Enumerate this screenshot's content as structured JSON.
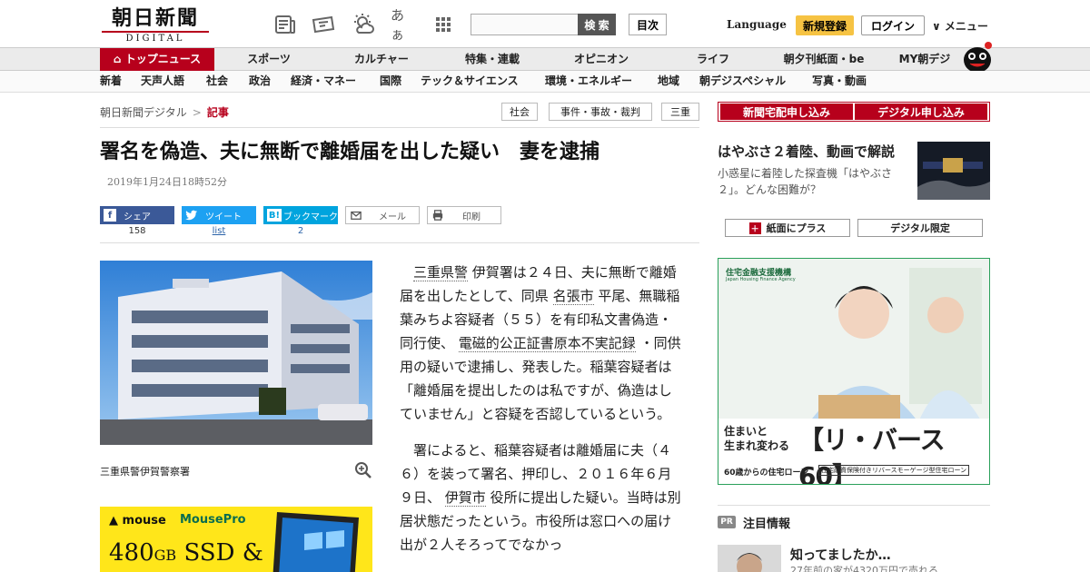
{
  "header": {
    "logo_jp": "朝日新聞",
    "logo_en": "DIGITAL",
    "icon_text_size": "あぁ",
    "search_placeholder": "",
    "search_label": "検 索",
    "toc_label": "目次",
    "language_label": "Language",
    "register_label": "新規登録",
    "login_label": "ログイン",
    "menu_label": "∨ メニュー"
  },
  "nav_main": [
    {
      "label": "トップニュース",
      "active": true
    },
    {
      "label": "スポーツ"
    },
    {
      "label": "カルチャー"
    },
    {
      "label": "特集・連載"
    },
    {
      "label": "オピニオン"
    },
    {
      "label": "ライフ"
    },
    {
      "label": "朝夕刊紙面・be"
    },
    {
      "label": "MY朝デジ"
    }
  ],
  "nav_sub": [
    "新着",
    "天声人語",
    "社会",
    "政治",
    "経済・マネー",
    "国際",
    "テック＆サイエンス",
    "環境・エネルギー",
    "地域",
    "朝デジスペシャル",
    "写真・動画"
  ],
  "breadcrumb": {
    "home": "朝日新聞デジタル",
    "sep": ">",
    "current": "記事"
  },
  "tags": [
    "社会",
    "事件・事故・裁判",
    "三重"
  ],
  "article": {
    "title": "署名を偽造、夫に無断で離婚届を出した疑い　妻を逮捕",
    "date": "2019年1月24日18時52分",
    "photo_caption": "三重県警伊賀警察署",
    "p1_a": "三重県警",
    "p1_b": " 伊賀署は２４日、夫に無断で離婚届を出したとして、同県 ",
    "p1_c": "名張市",
    "p1_d": " 平尾、無職稲葉みちよ容疑者（５５）を有印私文書偽造・同行使、 ",
    "p1_e": "電磁的公正証書原本不実記録",
    "p1_f": " ・同供用の疑いで逮捕し、発表した。稲葉容疑者は「離婚届を提出したのは私ですが、偽造はしていません」と容疑を否認しているという。",
    "p2_a": "署によると、稲葉容疑者は離婚届に夫（４６）を装って署名、押印し、２０１６年６月９日、 ",
    "p2_b": "伊賀市",
    "p2_c": " 役所に提出した疑い。当時は別居状態だったという。市役所は窓口への届け出が２人そろってでなかっ"
  },
  "share": {
    "facebook_label": "シェア",
    "facebook_count": "158",
    "twitter_label": "ツイート",
    "twitter_count": "list",
    "hatena_label": "ブックマーク",
    "hatena_count": "2",
    "mail_label": "メール",
    "print_label": "印刷"
  },
  "sidebar": {
    "subscribe_paper": "新聞宅配申し込み",
    "subscribe_digital": "デジタル申し込み",
    "feature_title": "はやぶさ２着陸、動画で解説",
    "feature_desc": "小惑星に着陸した探査機「はやぶさ２」。どんな困難が？",
    "tab_plus": "紙面にプラス",
    "tab_digital": "デジタル限定",
    "pr_badge": "PR",
    "pr_title": "注目情報",
    "pr_item_title": "知ってましたか…",
    "pr_item_desc": "27年前の家が4320万円で売れる"
  },
  "ads": {
    "pc_brand": "mouse",
    "pc_line": "MousePro",
    "pc_spec_num": "480",
    "pc_spec_unit": "GB",
    "pc_spec_rest": " SSD &",
    "jhf_org": "住宅金融支援機構",
    "jhf_org_en": "Japan Housing Finance Agency",
    "jhf_line1": "住まいと",
    "jhf_line2": "生まれ変わる",
    "jhf_product": "【リ・バース60】",
    "jhf_sub1": "60歳からの住宅ローン",
    "jhf_sub2": "住宅融資保険付きリバースモーゲージ型住宅ローン"
  },
  "colors": {
    "brand_red": "#b7001c",
    "facebook": "#3b5998",
    "twitter": "#1da1f2",
    "hatena": "#00a4de",
    "register_yellow": "#f6c343"
  }
}
